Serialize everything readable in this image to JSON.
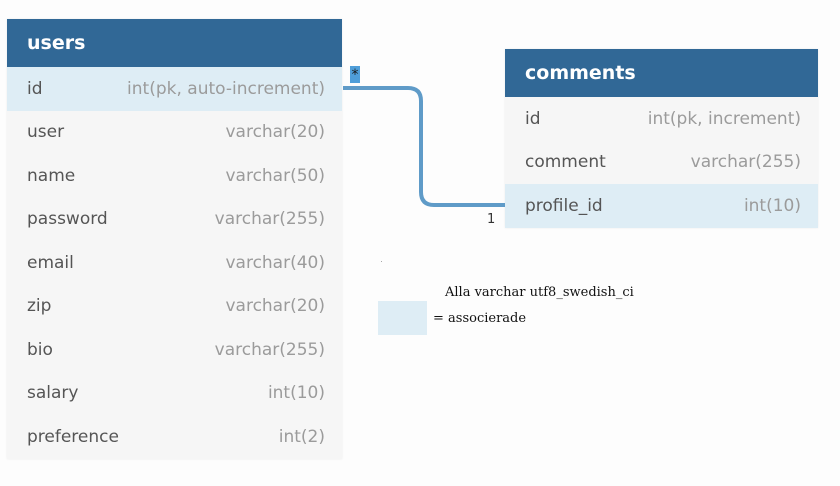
{
  "tables": {
    "users": {
      "title": "users",
      "rows": [
        {
          "name": "id",
          "type": "int(pk, auto-increment)",
          "associated": true
        },
        {
          "name": "user",
          "type": "varchar(20)",
          "associated": false
        },
        {
          "name": "name",
          "type": "varchar(50)",
          "associated": false
        },
        {
          "name": "password",
          "type": "varchar(255)",
          "associated": false
        },
        {
          "name": "email",
          "type": "varchar(40)",
          "associated": false
        },
        {
          "name": "zip",
          "type": "varchar(20)",
          "associated": false
        },
        {
          "name": "bio",
          "type": "varchar(255)",
          "associated": false
        },
        {
          "name": "salary",
          "type": "int(10)",
          "associated": false
        },
        {
          "name": "preference",
          "type": "int(2)",
          "associated": false
        }
      ]
    },
    "comments": {
      "title": "comments",
      "rows": [
        {
          "name": "id",
          "type": "int(pk, increment)",
          "associated": false
        },
        {
          "name": "comment",
          "type": "varchar(255)",
          "associated": false
        },
        {
          "name": "profile_id",
          "type": "int(10)",
          "associated": true
        }
      ]
    }
  },
  "relationship": {
    "from": "users.id",
    "to": "comments.profile_id",
    "from_cardinality": "*",
    "to_cardinality": "1"
  },
  "legend": {
    "line1": "Alla varchar utf8_swedish_ci",
    "line2": "= associerade"
  },
  "colors": {
    "header": "#316896",
    "associated_row": "#deedf5",
    "row": "#f6f6f6",
    "connector": "#5f9bc8"
  }
}
